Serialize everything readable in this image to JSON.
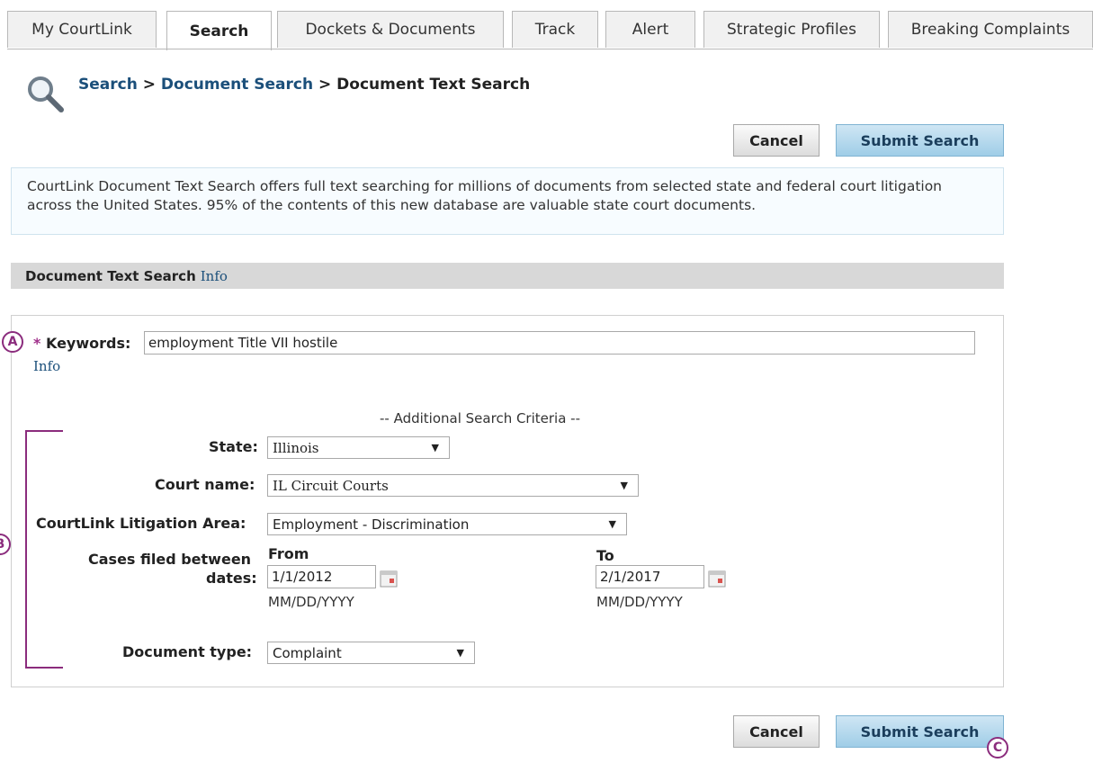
{
  "tabs": [
    {
      "label": "My CourtLink",
      "active": false
    },
    {
      "label": "Search",
      "active": true
    },
    {
      "label": "Dockets & Documents",
      "active": false
    },
    {
      "label": "Track",
      "active": false
    },
    {
      "label": "Alert",
      "active": false
    },
    {
      "label": "Strategic Profiles",
      "active": false
    },
    {
      "label": "Breaking Complaints",
      "active": false
    }
  ],
  "breadcrumb": {
    "link1": "Search",
    "sep1": " > ",
    "link2": "Document Search",
    "sep2": " > ",
    "current": "Document Text Search"
  },
  "buttons": {
    "cancel": "Cancel",
    "submit": "Submit Search"
  },
  "intro_text": "CourtLink Document Text Search offers full text searching for millions of documents from selected state and federal court litigation across the United States. 95% of the contents of this new database are valuable state court documents.",
  "section": {
    "title": "Document Text Search",
    "info_link": "Info"
  },
  "form": {
    "required_mark": "*",
    "keywords_label": "Keywords:",
    "keywords_value": "employment Title VII hostile",
    "keywords_info": "Info",
    "criteria_heading": "-- Additional Search Criteria --",
    "state_label": "State:",
    "state_value": "Illinois",
    "court_label": "Court name:",
    "court_value": "IL Circuit Courts",
    "area_label": "CourtLink Litigation Area:",
    "area_value": "Employment - Discrimination",
    "dates_label_1": "Cases filed between",
    "dates_label_2": "dates:",
    "from_label": "From",
    "to_label": "To",
    "from_value": "1/1/2012",
    "to_value": "2/1/2017",
    "date_format": "MM/DD/YYYY",
    "doctype_label": "Document type:",
    "doctype_value": "Complaint"
  },
  "annotations": {
    "a": "A",
    "b": "B",
    "c": "C"
  },
  "colors": {
    "link": "#1b4f7a",
    "annotation": "#8b2c7d",
    "submit_bg": "#a8d1ea",
    "section_bar": "#d8d8d8"
  }
}
